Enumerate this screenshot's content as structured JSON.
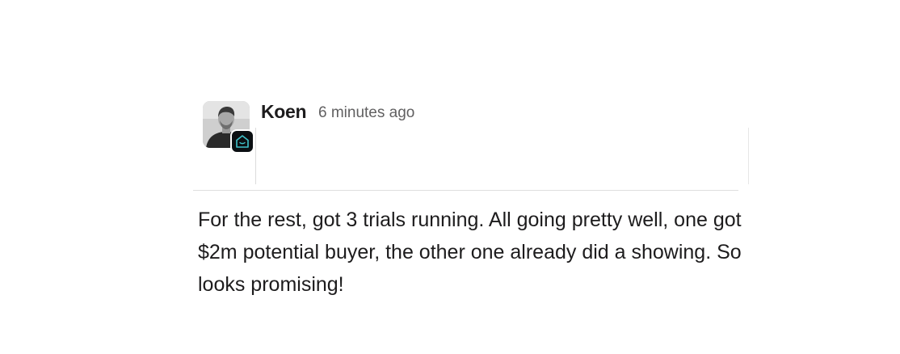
{
  "message": {
    "author": "Koen",
    "timestamp": "6 minutes ago",
    "text": "For the rest, got 3 trials running. All going pretty well, one got $2m potential buyer, the other one already did a showing. So looks promising!"
  },
  "colors": {
    "text": "#1d1c1d",
    "timestamp": "#616061",
    "badge_bg": "#0b0f12",
    "badge_accent": "#3fc1c9",
    "divider": "#dedede"
  },
  "icons": {
    "avatar": "user-avatar",
    "badge": "app-home-badge-icon"
  }
}
